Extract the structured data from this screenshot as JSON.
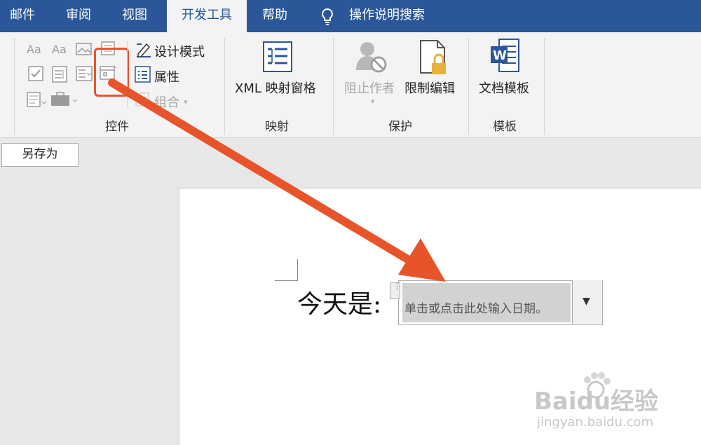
{
  "tabs": [
    {
      "label": "邮件",
      "active": false
    },
    {
      "label": "审阅",
      "active": false
    },
    {
      "label": "视图",
      "active": false
    },
    {
      "label": "开发工具",
      "active": true
    },
    {
      "label": "帮助",
      "active": false
    }
  ],
  "search": {
    "label": "操作说明搜索",
    "icon": "lightbulb-icon"
  },
  "ribbon": {
    "controls": {
      "group_label": "控件",
      "design_mode": "设计模式",
      "properties": "属性",
      "group": "组合",
      "icons": [
        "rich-text-content-control-icon",
        "plain-text-content-control-icon",
        "picture-content-control-icon",
        "building-block-gallery-icon",
        "checkbox-content-control-icon",
        "combo-box-content-control-icon",
        "dropdown-list-content-control-icon",
        "date-picker-content-control-icon",
        "legacy-tools-icon",
        "repeating-section-icon"
      ]
    },
    "mapping": {
      "group_label": "映射",
      "xml_pane": "XML 映射窗格"
    },
    "protect": {
      "group_label": "保护",
      "block_authors": "阻止作者",
      "restrict_editing": "限制编辑"
    },
    "templates": {
      "group_label": "模板",
      "doc_template": "文档模板"
    }
  },
  "toolbar": {
    "save_as": "另存为"
  },
  "document": {
    "text": "今天是:",
    "date_control_placeholder": "单击或点击此处输入日期。"
  },
  "watermark": {
    "logo": "Baidu经验",
    "url": "jingyan.baidu.com"
  },
  "colors": {
    "tabbar": "#2b579a",
    "annotation": "#e8542a"
  }
}
